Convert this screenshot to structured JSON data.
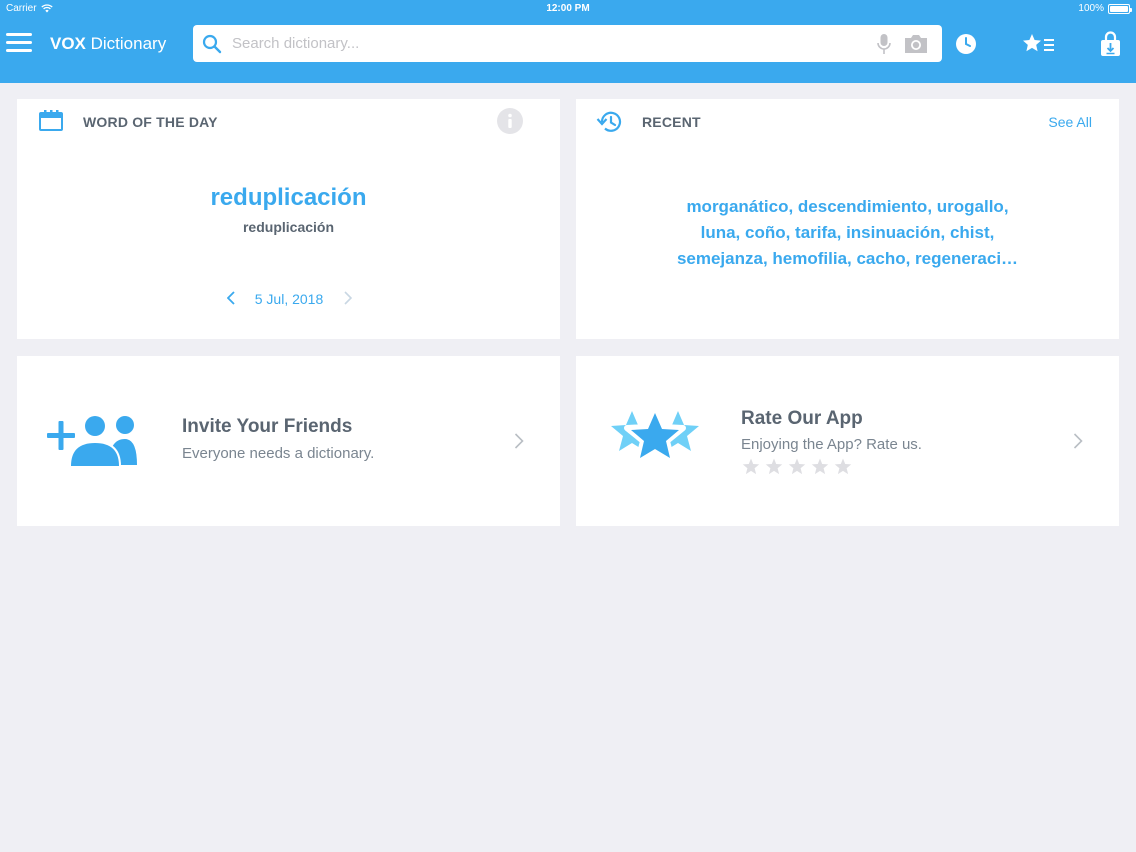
{
  "status_bar": {
    "carrier": "Carrier",
    "time": "12:00 PM",
    "battery": "100%"
  },
  "header": {
    "title_bold": "VOX",
    "title_rest": " Dictionary",
    "search_placeholder": "Search dictionary..."
  },
  "word_of_the_day": {
    "title": "WORD OF THE DAY",
    "word": "reduplicación",
    "headword": "reduplicación",
    "date": "5 Jul, 2018"
  },
  "recent": {
    "title": "RECENT",
    "see_all": "See All",
    "words_line1": "morganático, descendimiento, urogallo,",
    "words_line2": "luna, coño, tarifa, insinuación, chist,",
    "words_line3": "semejanza, hemofilia, cacho, regeneraci…"
  },
  "invite": {
    "title": "Invite Your Friends",
    "subtitle": "Everyone needs a dictionary."
  },
  "rate": {
    "title": "Rate Our App",
    "subtitle": "Enjoying the App? Rate us.",
    "stars_total": 5,
    "stars_filled": 0
  },
  "colors": {
    "accent": "#3aa9ee",
    "background": "#efeff4",
    "text_dark": "#5a6571",
    "text_muted": "#7a8590"
  }
}
